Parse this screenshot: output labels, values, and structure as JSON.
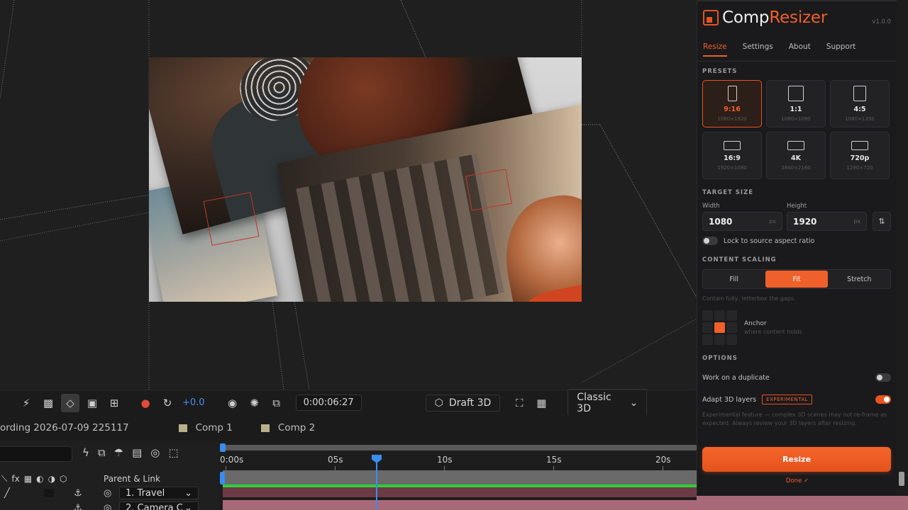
{
  "toolbar": {
    "exposure": "+0.0",
    "timecode": "0:00:06:27",
    "draft_label": "Draft 3D",
    "renderer": "Classic 3D",
    "icons": [
      "snap-icon",
      "transparency-grid-icon",
      "mask-path-icon",
      "region-of-interest-icon",
      "3d-view-icon",
      "color-channels-icon",
      "reset-exposure-icon",
      "camera-snapshot-icon",
      "show-snapshot-icon",
      "region-icon"
    ]
  },
  "tabs": {
    "recording": "ording 2026-07-09 225117",
    "comp1": "Comp 1",
    "comp2": "Comp 2"
  },
  "timeline": {
    "parent_link": "Parent & Link",
    "ruler": [
      "0:00s",
      "05s",
      "10s",
      "15s",
      "20s"
    ],
    "layers": [
      "1. Travel",
      "2. Camera C"
    ]
  },
  "plugin": {
    "name_part1": "Comp",
    "name_part2": "Resizer",
    "version": "v1.0.0",
    "nav": [
      "Resize",
      "Settings",
      "About",
      "Support"
    ],
    "presets_label": "PRESETS",
    "presets": [
      {
        "name": "9:16",
        "dims": "1080×1920",
        "active": true
      },
      {
        "name": "1:1",
        "dims": "1080×1080",
        "active": false
      },
      {
        "name": "4:5",
        "dims": "1080×1350",
        "active": false
      },
      {
        "name": "16:9",
        "dims": "1920×1080",
        "active": false
      },
      {
        "name": "4K",
        "dims": "3840×2160",
        "active": false
      },
      {
        "name": "720p",
        "dims": "1280×720",
        "active": false
      }
    ],
    "target_size_label": "TARGET SIZE",
    "width_label": "Width",
    "height_label": "Height",
    "width_value": "1080",
    "height_value": "1920",
    "unit": "px",
    "swap_icon": "⇅",
    "lock_label": "Lock to source aspect ratio",
    "content_scaling_label": "CONTENT SCALING",
    "scaling_options": [
      "Fill",
      "Fit",
      "Stretch"
    ],
    "scaling_active": "Fit",
    "scaling_hint": "Contain fully, letterbox the gaps.",
    "anchor_label": "Anchor",
    "anchor_sub": "where content holds",
    "options_label": "OPTIONS",
    "duplicate_label": "Work on a duplicate",
    "adapt3d_label": "Adapt 3D layers",
    "experimental_badge": "EXPERIMENTAL",
    "experimental_note": "Experimental feature — complex 3D scenes may not re-frame as expected. Always review your 3D layers after resizing.",
    "resize_button": "Resize",
    "done_text": "Done ✓",
    "accent": "#f0602a"
  }
}
